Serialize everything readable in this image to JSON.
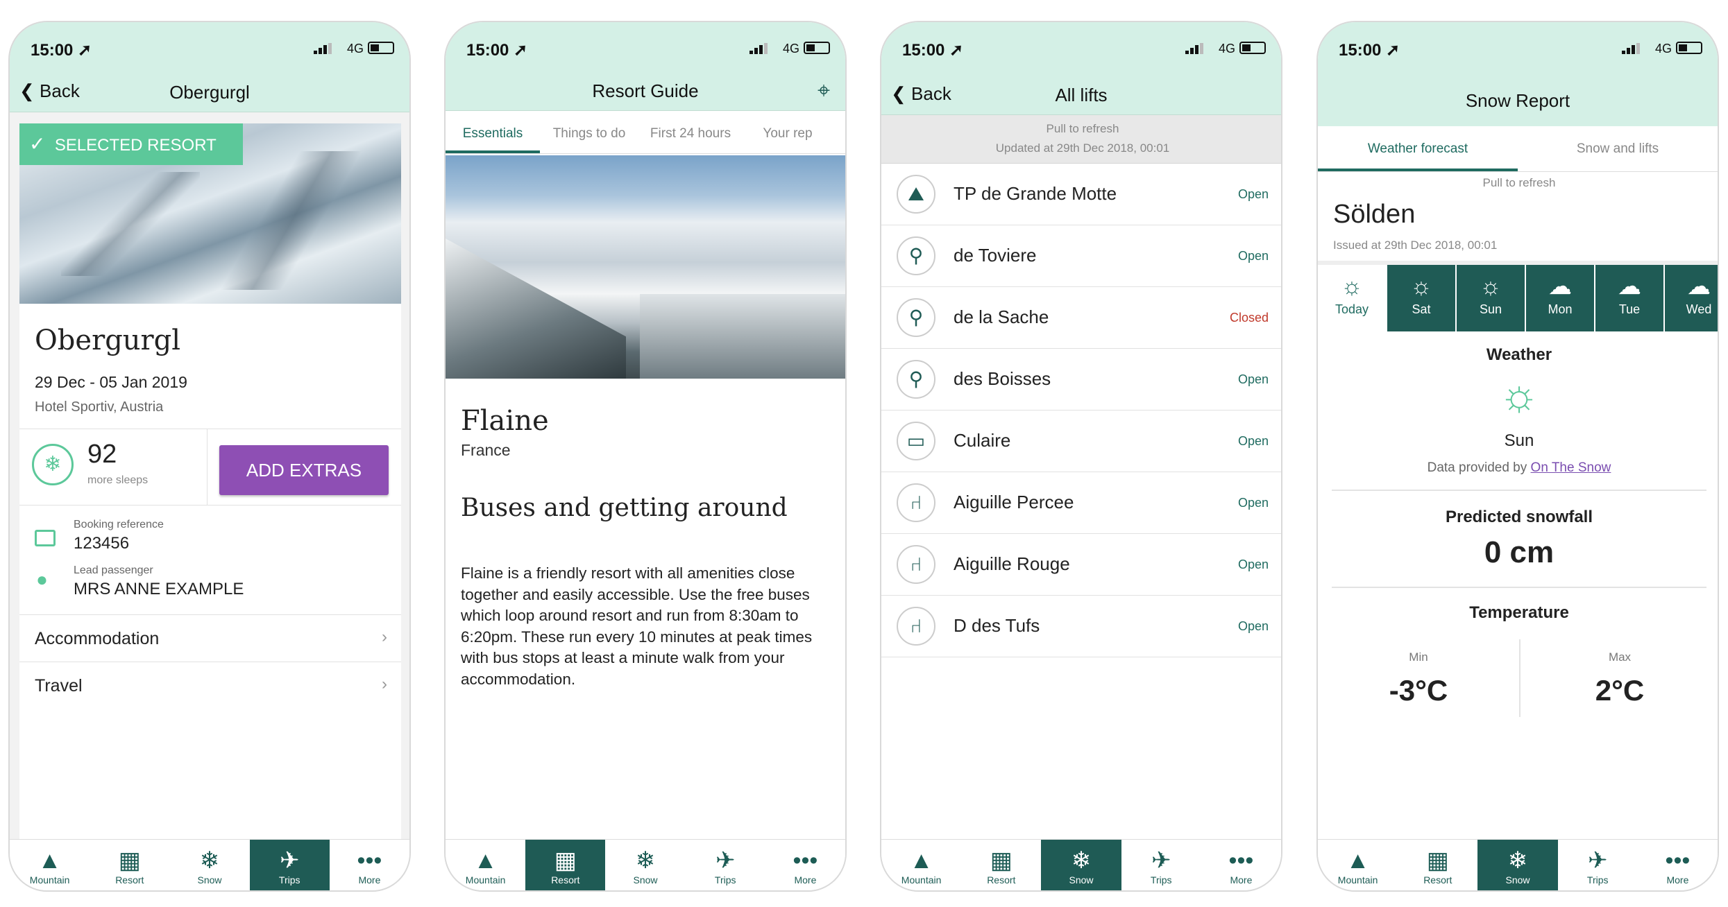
{
  "status": {
    "time": "15:00 ➚",
    "network": "4G"
  },
  "phone1": {
    "nav": {
      "back": "Back",
      "title": "Obergurgl"
    },
    "badge": "SELECTED RESORT",
    "resort_name": "Obergurgl",
    "dates": "29 Dec - 05 Jan 2019",
    "hotel": "Hotel Sportiv, Austria",
    "sleeps_count": "92",
    "sleeps_label": "more sleeps",
    "add_extras": "ADD EXTRAS",
    "booking_ref_label": "Booking reference",
    "booking_ref": "123456",
    "lead_label": "Lead passenger",
    "lead_name": "MRS ANNE EXAMPLE",
    "menu": [
      "Accommodation",
      "Travel"
    ]
  },
  "phone2": {
    "nav": {
      "title": "Resort Guide"
    },
    "tabs": [
      "Essentials",
      "Things to do",
      "First 24 hours",
      "Your rep"
    ],
    "resort": "Flaine",
    "country": "France",
    "heading": "Buses and getting around",
    "body": "Flaine is a friendly resort with all amenities close together and easily accessible. Use the free buses which loop around resort and run from 8:30am to 6:20pm. These run every 10 minutes at peak times with bus stops at least a minute walk from your accommodation."
  },
  "phone3": {
    "nav": {
      "back": "Back",
      "title": "All lifts"
    },
    "refresh": "Pull to refresh",
    "updated": "Updated at 29th Dec 2018, 00:01",
    "lifts": [
      {
        "name": "TP de Grande Motte",
        "status": "Open",
        "icon": "funicular-icon"
      },
      {
        "name": "de Toviere",
        "status": "Open",
        "icon": "gondola-icon"
      },
      {
        "name": "de la Sache",
        "status": "Closed",
        "icon": "gondola-icon"
      },
      {
        "name": "des Boisses",
        "status": "Open",
        "icon": "gondola-icon"
      },
      {
        "name": "Culaire",
        "status": "Open",
        "icon": "cable-car-icon"
      },
      {
        "name": "Aiguille Percee",
        "status": "Open",
        "icon": "chairlift-icon"
      },
      {
        "name": "Aiguille Rouge",
        "status": "Open",
        "icon": "chairlift-icon"
      },
      {
        "name": "D  des Tufs",
        "status": "Open",
        "icon": "chairlift-icon"
      }
    ]
  },
  "phone4": {
    "nav": {
      "title": "Snow Report"
    },
    "tabs": [
      "Weather forecast",
      "Snow and lifts"
    ],
    "refresh": "Pull to refresh",
    "resort": "Sölden",
    "issued": "Issued at 29th Dec 2018, 00:01",
    "days": [
      {
        "label": "Today",
        "icon": "sun-icon"
      },
      {
        "label": "Sat",
        "icon": "sun-icon"
      },
      {
        "label": "Sun",
        "icon": "sun-icon"
      },
      {
        "label": "Mon",
        "icon": "snow-cloud-icon"
      },
      {
        "label": "Tue",
        "icon": "cloud-icon"
      },
      {
        "label": "Wed",
        "icon": "cloud-icon"
      }
    ],
    "weather_title": "Weather",
    "weather_value": "Sun",
    "provider_prefix": "Data provided by",
    "provider_link": "On The Snow",
    "snowfall_title": "Predicted snowfall",
    "snowfall_value": "0 cm",
    "temp_title": "Temperature",
    "min_label": "Min",
    "min_value": "-3°C",
    "max_label": "Max",
    "max_value": "2°C"
  },
  "tabbar": [
    "Mountain",
    "Resort",
    "Snow",
    "Trips",
    "More"
  ],
  "colors": {
    "mint": "#d4f0e6",
    "dark_teal": "#1f5b55",
    "purple": "#8e4fb4",
    "badge_green": "#5cc89a"
  }
}
